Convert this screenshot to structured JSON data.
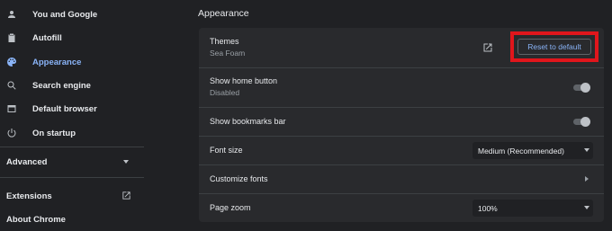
{
  "sidebar": {
    "items": [
      {
        "label": "You and Google",
        "icon": "person-icon"
      },
      {
        "label": "Autofill",
        "icon": "clipboard-icon"
      },
      {
        "label": "Appearance",
        "icon": "palette-icon",
        "active": true
      },
      {
        "label": "Search engine",
        "icon": "search-icon"
      },
      {
        "label": "Default browser",
        "icon": "browser-window-icon"
      },
      {
        "label": "On startup",
        "icon": "power-icon"
      }
    ],
    "advanced_label": "Advanced",
    "extensions_label": "Extensions",
    "about_label": "About Chrome"
  },
  "main": {
    "section_title": "Appearance",
    "themes": {
      "label": "Themes",
      "value": "Sea Foam",
      "button": "Reset to default"
    },
    "home_button": {
      "label": "Show home button",
      "value": "Disabled",
      "enabled": false
    },
    "bookmarks_bar": {
      "label": "Show bookmarks bar",
      "enabled": false
    },
    "font_size": {
      "label": "Font size",
      "selected": "Medium (Recommended)"
    },
    "customize_fonts": {
      "label": "Customize fonts"
    },
    "page_zoom": {
      "label": "Page zoom",
      "selected": "100%"
    }
  },
  "colors": {
    "background": "#202124",
    "card": "#292a2d",
    "accent": "#8ab4f8",
    "highlight_box": "#e0161c"
  }
}
